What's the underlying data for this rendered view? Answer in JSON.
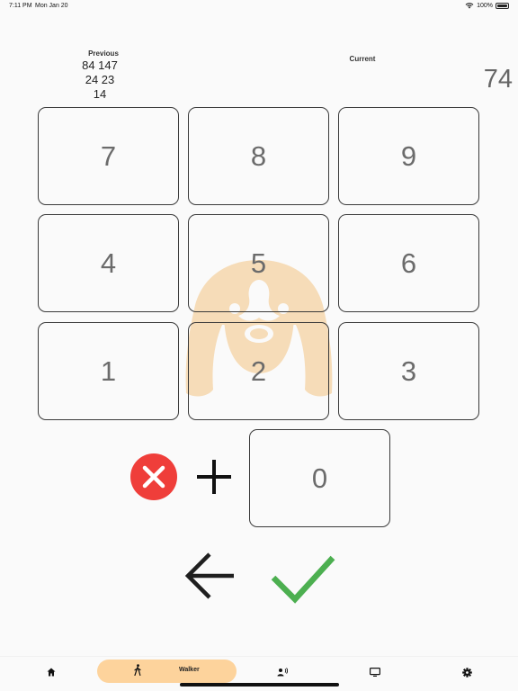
{
  "status_bar": {
    "time": "7:11 PM",
    "date": "Mon Jan 20",
    "battery": "100%"
  },
  "previous": {
    "label": "Previous",
    "lines": [
      "84 147",
      "24 23",
      "14"
    ]
  },
  "current": {
    "label": "Current",
    "value": "74"
  },
  "keypad": {
    "keys": [
      "7",
      "8",
      "9",
      "4",
      "5",
      "6",
      "1",
      "2",
      "3"
    ],
    "zero": "0"
  },
  "actions": {
    "clear_icon": "close-circle-icon",
    "plus_icon": "plus-icon",
    "back_icon": "arrow-left-icon",
    "confirm_icon": "checkmark-icon"
  },
  "nav": {
    "items": [
      {
        "icon": "home-icon"
      },
      {
        "icon": "walk-icon",
        "label": "Walker",
        "active": true
      },
      {
        "icon": "person-voice-icon"
      },
      {
        "icon": "tv-icon"
      },
      {
        "icon": "gear-icon"
      }
    ]
  },
  "colors": {
    "accent": "#fdd39c",
    "clear_red": "#ef3e3a",
    "confirm_green": "#4caf50",
    "watermark": "#f6dcb8"
  }
}
